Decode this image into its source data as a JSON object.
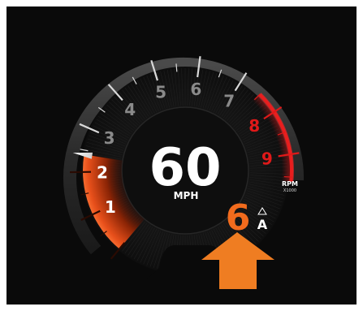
{
  "speedometer": {
    "speed": "60",
    "speed_unit": "MPH"
  },
  "tachometer": {
    "rpm_label": "RPM",
    "rpm_multiplier": "X1000",
    "tick_labels": [
      "1",
      "2",
      "3",
      "4",
      "5",
      "6",
      "7",
      "8",
      "9"
    ],
    "redline_labels": [
      "8",
      "9"
    ],
    "needle_value": 2.4
  },
  "transmission": {
    "gear": "6",
    "mode": "A"
  },
  "colors": {
    "background": "#0a0a0a",
    "tick_label": "#8a8a8a",
    "redline": "#e01919",
    "rpm_fill": "#e8501b",
    "gear_accent": "#f26b1d",
    "arrow": "#ef7d22",
    "text_primary": "#ffffff"
  },
  "icons": {
    "shift_hint": "triangle-up-icon",
    "pointer": "arrow-up-icon"
  }
}
